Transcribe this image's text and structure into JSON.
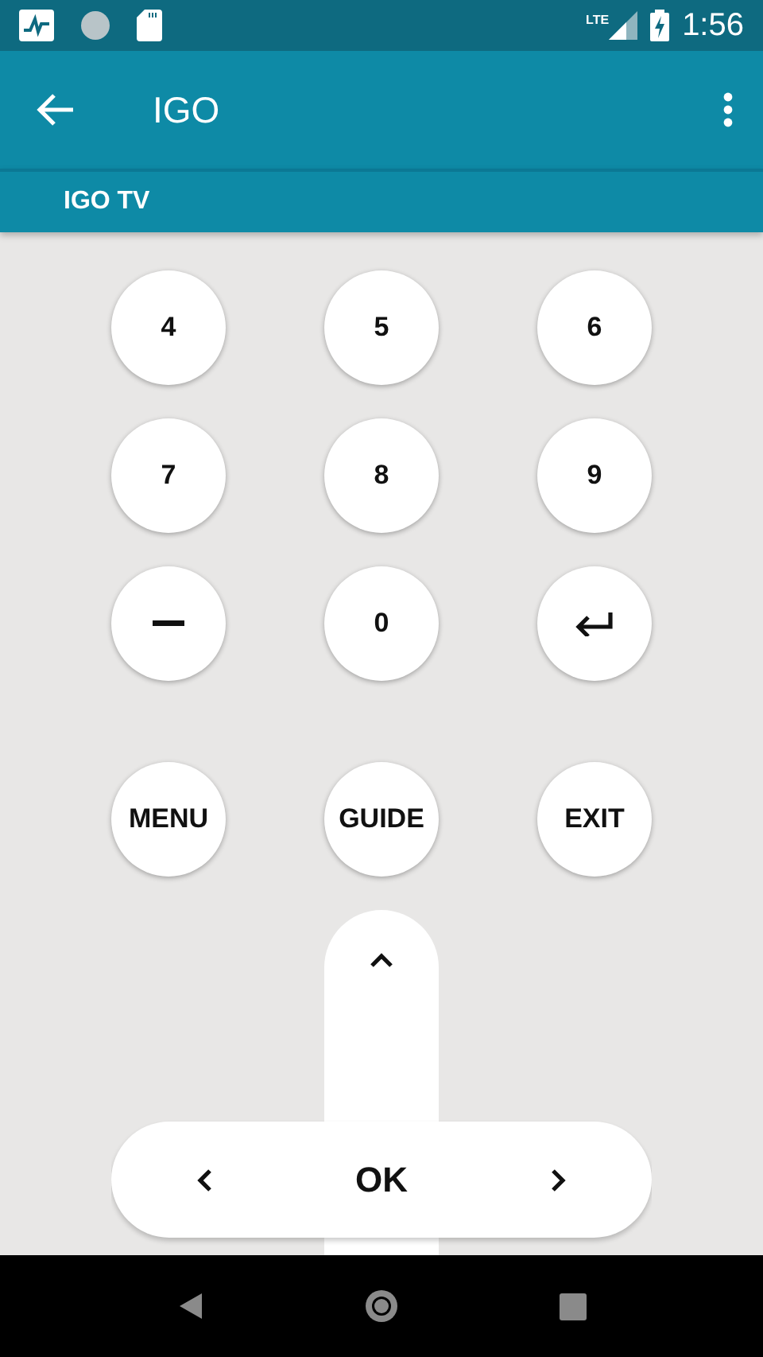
{
  "status_bar": {
    "network": "LTE",
    "time": "1:56"
  },
  "app_bar": {
    "title": "IGO"
  },
  "tabs": [
    {
      "label": "IGO TV"
    }
  ],
  "keypad": [
    {
      "kind": "text",
      "label": "4"
    },
    {
      "kind": "text",
      "label": "5"
    },
    {
      "kind": "text",
      "label": "6"
    },
    {
      "kind": "text",
      "label": "7"
    },
    {
      "kind": "text",
      "label": "8"
    },
    {
      "kind": "text",
      "label": "9"
    },
    {
      "kind": "dash"
    },
    {
      "kind": "text",
      "label": "0"
    },
    {
      "kind": "enter"
    }
  ],
  "function_keys": [
    {
      "label": "MENU"
    },
    {
      "label": "GUIDE"
    },
    {
      "label": "EXIT"
    }
  ],
  "dpad": {
    "center": "OK"
  }
}
